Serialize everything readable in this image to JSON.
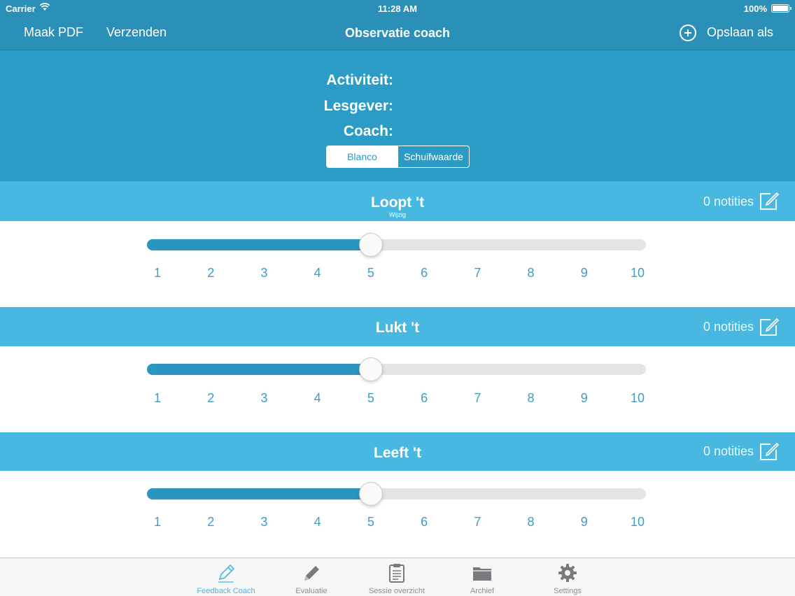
{
  "status_bar": {
    "carrier": "Carrier",
    "time": "11:28 AM",
    "battery": "100%",
    "wifi_icon": "wifi-icon",
    "battery_icon": "battery-icon"
  },
  "nav": {
    "left_buttons": [
      "Maak PDF",
      "Verzenden"
    ],
    "title": "Observatie coach",
    "right_button": "Opslaan als",
    "right_icon": "plus-circle-icon"
  },
  "info": {
    "fields": [
      "Activiteit:",
      "Lesgever:",
      "Coach:"
    ],
    "segments": [
      "Blanco",
      "Schuifwaarde"
    ],
    "selected_segment": "Schuifwaarde"
  },
  "sections": [
    {
      "title": "Loopt 't",
      "notes": "0 notities",
      "edit_hint": "Wijzig",
      "value": 5,
      "min": 1,
      "max": 10
    },
    {
      "title": "Lukt 't",
      "notes": "0 notities",
      "value": 5,
      "min": 1,
      "max": 10
    },
    {
      "title": "Leeft 't",
      "notes": "0 notities",
      "value": 5,
      "min": 1,
      "max": 10
    }
  ],
  "scale_labels": [
    "1",
    "2",
    "3",
    "4",
    "5",
    "6",
    "7",
    "8",
    "9",
    "10"
  ],
  "tabs": [
    {
      "label": "Feedback Coach",
      "icon": "pencil-icon",
      "active": true
    },
    {
      "label": "Evaluatie",
      "icon": "pencil-icon",
      "active": false
    },
    {
      "label": "Sessie overzicht",
      "icon": "clipboard-icon",
      "active": false
    },
    {
      "label": "Archief",
      "icon": "folder-icon",
      "active": false
    },
    {
      "label": "Settings",
      "icon": "gear-icon",
      "active": false
    }
  ],
  "colors": {
    "nav_bg": "#2a90b8",
    "info_bg": "#2a9cc6",
    "section_header_bg": "#48b8e0",
    "slider_fill": "#2a96c0",
    "slider_track": "#e4e4e6",
    "tick_text": "#3f9dc6",
    "tab_active": "#48b8e0",
    "tab_inactive": "#8e8e93"
  }
}
